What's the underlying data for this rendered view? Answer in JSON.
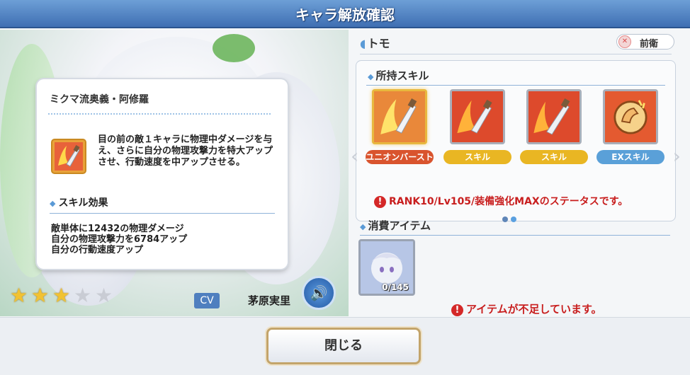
{
  "title": "キャラ解放確認",
  "character": {
    "name": "トモ",
    "position": "前衛",
    "stars_on": 3,
    "stars_total": 5,
    "cv_label": "CV",
    "cv_name": "茅原実里"
  },
  "popup": {
    "skill_name": "ミクマ流奥義・阿修羅",
    "description": "目の前の敵１キャラに物理中ダメージを与え、さらに自分の物理攻撃力を特大アップさせ、行動速度を中アップさせる。",
    "effect_header": "スキル効果",
    "effects": [
      "敵単体に12432の物理ダメージ",
      "自分の物理攻撃力を6784アップ",
      "自分の行動速度アップ"
    ]
  },
  "skills": {
    "header": "所持スキル",
    "items": [
      {
        "tag": "ユニオンバースト",
        "icon": "slash-fire-icon"
      },
      {
        "tag": "スキル",
        "icon": "slash-fire-icon"
      },
      {
        "tag": "スキル",
        "icon": "slash-fire-icon"
      },
      {
        "tag": "EXスキル",
        "icon": "flex-arm-icon"
      }
    ],
    "notice": "RANK10/Lv105/装備強化MAXのステータスです。"
  },
  "items": {
    "header": "消費アイテム",
    "quantity": "0/145",
    "warning": "アイテムが不足しています。"
  },
  "close_label": "閉じる",
  "colors": {
    "title_bar": "#4f7fc0",
    "warning": "#c81e1e",
    "accent": "#5a9ad6"
  }
}
